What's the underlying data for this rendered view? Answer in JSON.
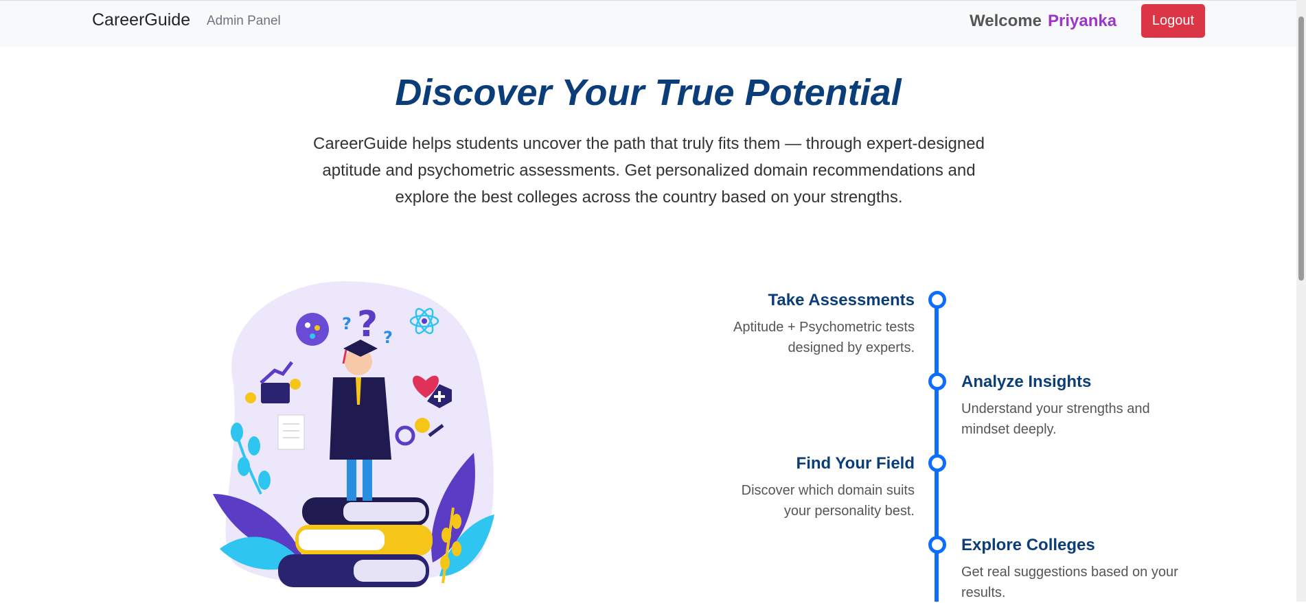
{
  "nav": {
    "brand": "CareerGuide",
    "admin_link": "Admin Panel",
    "welcome": "Welcome",
    "username": "Priyanka",
    "logout": "Logout"
  },
  "hero": {
    "title": "Discover Your True Potential",
    "description": "CareerGuide helps students uncover the path that truly fits them — through expert-designed aptitude and psychometric assessments. Get personalized domain recommendations and explore the best colleges across the country based on your strengths."
  },
  "timeline": [
    {
      "title": "Take Assessments",
      "desc": "Aptitude + Psychometric tests designed by experts."
    },
    {
      "title": "Analyze Insights",
      "desc": "Understand your strengths and mindset deeply."
    },
    {
      "title": "Find Your Field",
      "desc": "Discover which domain suits your personality best."
    },
    {
      "title": "Explore Colleges",
      "desc": "Get real suggestions based on your results."
    }
  ],
  "colors": {
    "brand_blue": "#0b3d78",
    "timeline_blue": "#0d6efd",
    "logout_red": "#dc3545",
    "username_purple": "#9c35c9"
  }
}
